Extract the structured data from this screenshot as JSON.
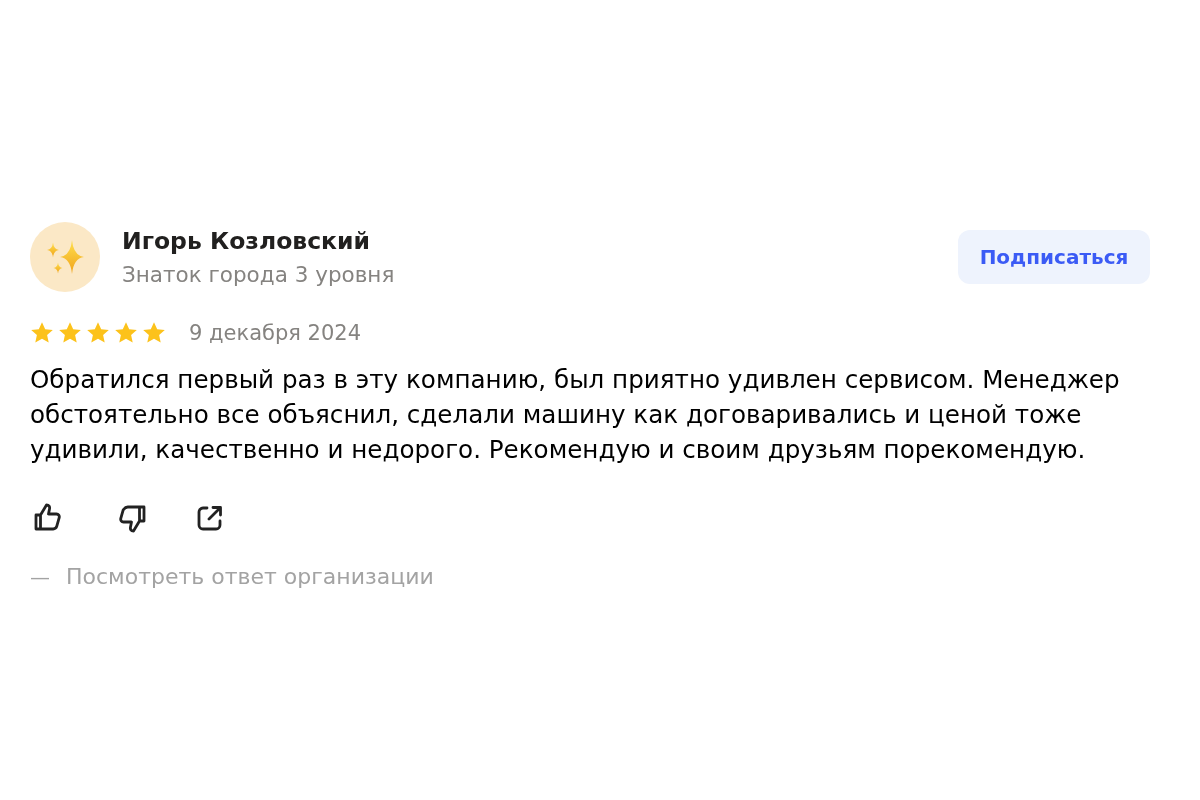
{
  "author": {
    "name": "Игорь Козловский",
    "status": "Знаток города 3 уровня"
  },
  "subscribe_button": {
    "label": "Подписаться"
  },
  "rating": {
    "stars": 5,
    "date": "9 декабря 2024"
  },
  "review_text": "Обратился первый раз в эту компанию, был приятно удивлен сервисом. Менеджер обстоятельно все объяснил, сделали машину как договаривались и ценой тоже удивили, качественно и недорого. Рекомендую и своим друзьям порекомендую.",
  "actions": [
    {
      "kind": "like"
    },
    {
      "kind": "dislike"
    },
    {
      "kind": "share"
    }
  ],
  "response_toggle": {
    "marker": "—",
    "label": "Посмотреть ответ организации"
  }
}
